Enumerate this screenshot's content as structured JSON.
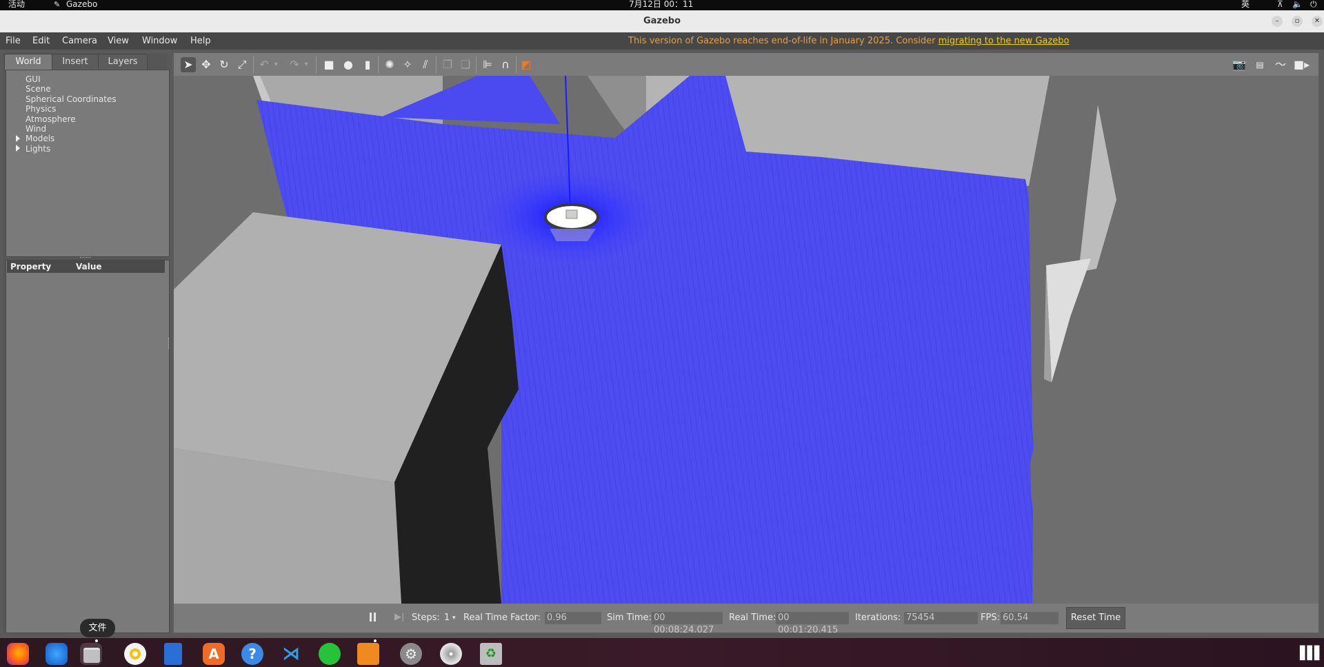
{
  "system_bar": {
    "activities": "活动",
    "app_name": "Gazebo",
    "clock": "7月12日  00：11",
    "input_method": "英"
  },
  "window": {
    "title": "Gazebo",
    "minimize": "–",
    "maximize": "▫",
    "close": "✕"
  },
  "menu": {
    "items": [
      "File",
      "Edit",
      "Camera",
      "View",
      "Window",
      "Help"
    ],
    "eol_notice": "This version of Gazebo reaches end-of-life in January 2025. Consider ",
    "eol_link": "migrating to the new Gazebo"
  },
  "left_panel": {
    "tabs": [
      "World",
      "Insert",
      "Layers"
    ],
    "active_tab": "World",
    "tree": [
      "GUI",
      "Scene",
      "Spherical Coordinates",
      "Physics",
      "Atmosphere",
      "Wind",
      "Models",
      "Lights"
    ],
    "property_header": {
      "property": "Property",
      "value": "Value"
    }
  },
  "toolbar": {
    "left_tools": [
      "select-mode",
      "translate-mode",
      "rotate-mode",
      "scale-mode",
      "undo",
      "undo-history",
      "redo",
      "redo-history",
      "box-shape",
      "sphere-shape",
      "cylinder-shape",
      "point-light",
      "spot-light",
      "directional-light",
      "copy",
      "paste",
      "align",
      "snap",
      "change-view"
    ],
    "right_tools": [
      "screenshot",
      "log",
      "plot",
      "video-record"
    ]
  },
  "status_bar": {
    "steps_label": "Steps:",
    "steps_value": "1",
    "rtf_label": "Real Time Factor:",
    "rtf_value": "0.96",
    "sim_time_label": "Sim Time:",
    "sim_time_value": "00 00:08:24.027",
    "real_time_label": "Real Time:",
    "real_time_value": "00 00:01:20.415",
    "iterations_label": "Iterations:",
    "iterations_value": "75454",
    "fps_label": "FPS:",
    "fps_value": "60.54",
    "reset_button": "Reset Time"
  },
  "tooltip": "文件",
  "dock": {
    "apps": [
      "firefox",
      "thunderbird",
      "files",
      "rhythmbox",
      "writer",
      "app-center",
      "help",
      "vscode",
      "wechat",
      "gazebo",
      "settings",
      "disc",
      "trash"
    ],
    "active_app": "files"
  },
  "colors": {
    "laser": "#3b3bff",
    "wall": "#b4b4b4",
    "ground": "#6e6e6e",
    "accent": "#e8a040",
    "link": "#f0d000"
  }
}
